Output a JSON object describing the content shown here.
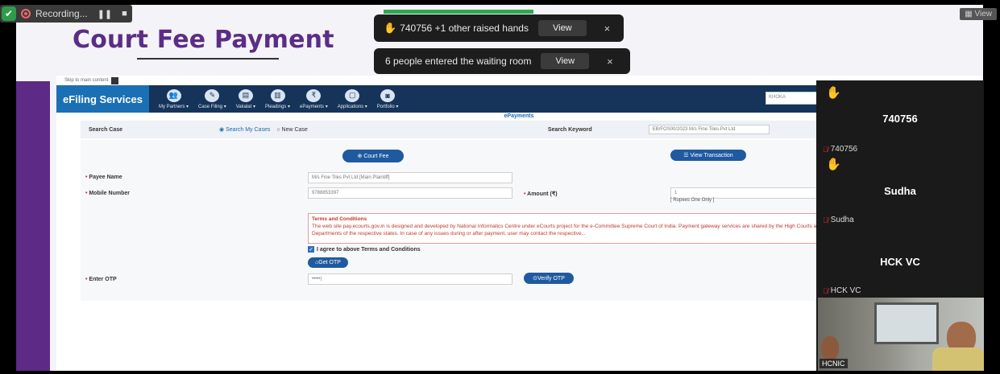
{
  "recording": {
    "label": "Recording...",
    "pause": "❚❚",
    "stop": "■"
  },
  "top_view": "View",
  "slide": {
    "title": "Court Fee Payment"
  },
  "notifications": {
    "hands": {
      "text": "740756 +1 other raised hands",
      "view": "View",
      "close": "×"
    },
    "waiting": {
      "text": "6 people entered the waiting room",
      "view": "View",
      "close": "×"
    }
  },
  "app": {
    "skip": "Skip to main content",
    "brand": "eFiling Services",
    "nav": [
      {
        "label": "My Partners ▾"
      },
      {
        "label": "Case Filing ▾"
      },
      {
        "label": "Vakalat ▾"
      },
      {
        "label": "Pleadings ▾"
      },
      {
        "label": "ePayments ▾"
      },
      {
        "label": "Applications ▾"
      },
      {
        "label": "Portfolio ▾"
      }
    ],
    "search_placeholder": "KHOKA",
    "section_title": "ePayments",
    "search_case_label": "Search Case",
    "radio_my_cases": "Search My Cases",
    "radio_new_case": "New Case",
    "search_keyword_label": "Search Keyword",
    "search_keyword_value": "EB/FOS00/2023 M/s Fine Tiles Pvt Ltd",
    "court_fee_btn": "Court Fee",
    "view_txn_btn": "View Transaction",
    "payee_label": "Payee Name",
    "payee_value": "M/s Fine Tiles Pvt Ltd [Main Plaintiff]",
    "mobile_label": "Mobile Number",
    "mobile_value": "9788853397",
    "amount_label": "Amount (₹)",
    "amount_value": "1",
    "rupees_note": "[ Rupees One Only ]",
    "terms_heading": "Terms and Conditions",
    "terms_text": "The web site pay.ecourts.gov.in is designed and developed by National Informatics Centre under eCourts project for the e-Committee Supreme Court of India. Payment gateway services are shared by the High Courts and Government Finance Departments of the respective states. In case of any issues during or after payment, user may contact the respective...",
    "agree_text": "I agree to above Terms and Conditions",
    "get_otp_btn": "Get OTP",
    "otp_label": "Enter OTP",
    "otp_value": "•••••|",
    "verify_otp_btn": "Verify OTP"
  },
  "participants": [
    {
      "big": "740756",
      "small": "740756"
    },
    {
      "big": "Sudha",
      "small": "Sudha"
    },
    {
      "big": "HCK VC",
      "small": "HCK VC"
    }
  ],
  "video_label": "HCNIC"
}
